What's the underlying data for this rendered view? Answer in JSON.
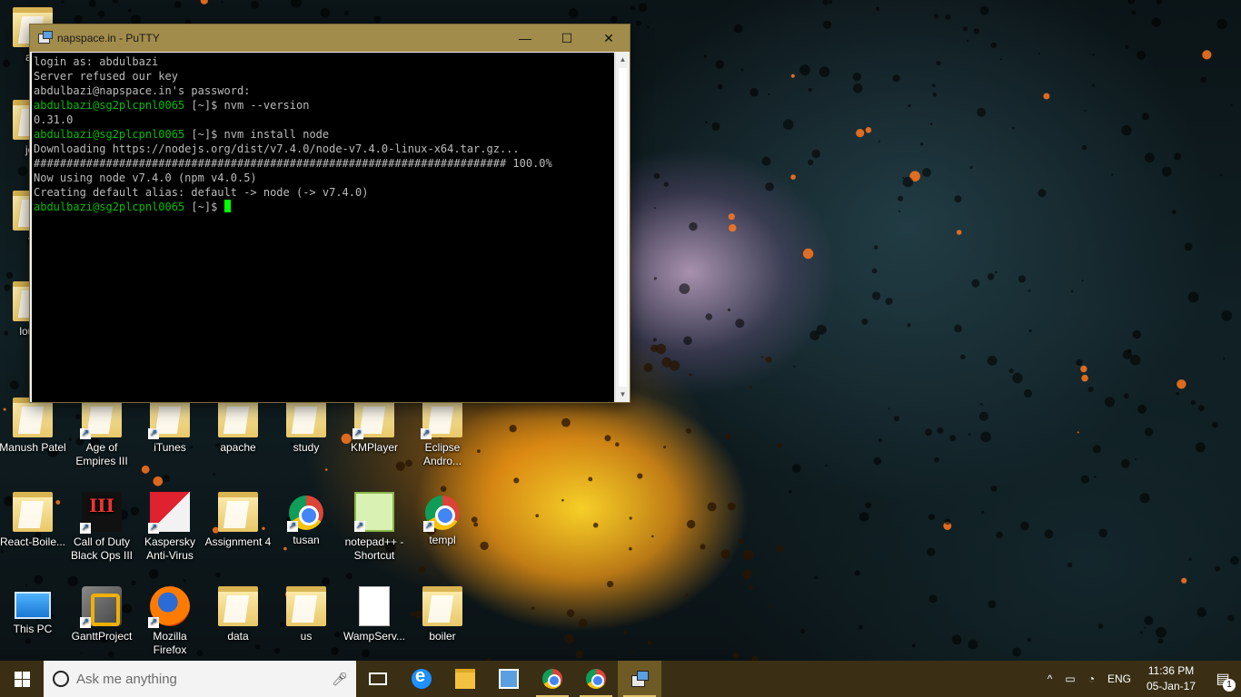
{
  "colors": {
    "titlebar": "#a28c4b",
    "taskbar": "#3a2f14",
    "terminal_bg": "#000000",
    "terminal_fg": "#bbbbbb",
    "prompt_green": "#00c000"
  },
  "putty": {
    "title": "napspace.in - PuTTY",
    "minimize_glyph": "—",
    "maximize_glyph": "☐",
    "close_glyph": "✕",
    "terminal": {
      "lines": [
        {
          "text": "login as: abdulbazi"
        },
        {
          "text": "Server refused our key"
        },
        {
          "text": "abdulbazi@napspace.in's password:"
        },
        {
          "prompt": "abdulbazi@sg2plcpnl0065",
          "text": " [~]$ nvm --version"
        },
        {
          "text": "0.31.0"
        },
        {
          "prompt": "abdulbazi@sg2plcpnl0065",
          "text": " [~]$ nvm install node"
        },
        {
          "text": "Downloading https://nodejs.org/dist/v7.4.0/node-v7.4.0-linux-x64.tar.gz..."
        },
        {
          "text": "######################################################################## 100.0%"
        },
        {
          "text": "Now using node v7.4.0 (npm v4.0.5)"
        },
        {
          "text": "Creating default alias: default -> node (-> v7.4.0)"
        },
        {
          "prompt": "abdulbazi@sg2plcpnl0065",
          "text": " [~]$ ",
          "cursor": true
        }
      ]
    }
  },
  "desktop": {
    "icons": [
      {
        "label": "api",
        "kind": "folder"
      },
      {
        "label": "jou",
        "kind": "folder"
      },
      {
        "label": "fo",
        "kind": "folder"
      },
      {
        "label": "loung",
        "kind": "folder"
      },
      {
        "label": "Manush Patel",
        "kind": "folder"
      },
      {
        "label": "Age of Empires III",
        "kind": "shortcut"
      },
      {
        "label": "iTunes",
        "kind": "shortcut"
      },
      {
        "label": "apache",
        "kind": "folder"
      },
      {
        "label": "study",
        "kind": "folder"
      },
      {
        "label": "KMPlayer",
        "kind": "shortcut"
      },
      {
        "label": "Eclipse Andro...",
        "kind": "shortcut"
      },
      {
        "label": "React-Boile...",
        "kind": "folder"
      },
      {
        "label": "Call of Duty Black Ops III",
        "kind": "game"
      },
      {
        "label": "Kaspersky Anti-Virus",
        "kind": "kaspersky"
      },
      {
        "label": "Assignment 4",
        "kind": "folder"
      },
      {
        "label": "tusan",
        "kind": "chrome"
      },
      {
        "label": "notepad++ - Shortcut",
        "kind": "notepad"
      },
      {
        "label": "templ",
        "kind": "chrome"
      },
      {
        "label": "This PC",
        "kind": "pc"
      },
      {
        "label": "GanttProject",
        "kind": "gantt"
      },
      {
        "label": "Mozilla Firefox",
        "kind": "firefox"
      },
      {
        "label": "data",
        "kind": "folder"
      },
      {
        "label": "us",
        "kind": "folder"
      },
      {
        "label": "WampServ...",
        "kind": "doc"
      },
      {
        "label": "boiler",
        "kind": "folder"
      }
    ]
  },
  "taskbar": {
    "search_placeholder": "Ask me anything",
    "apps": [
      {
        "name": "task-view",
        "icon": "taskview-icon"
      },
      {
        "name": "edge",
        "icon": "edge-icon"
      },
      {
        "name": "file-explorer",
        "icon": "folder-icon"
      },
      {
        "name": "store",
        "icon": "store-icon"
      },
      {
        "name": "chrome-1",
        "icon": "chrome-icon"
      },
      {
        "name": "chrome-2",
        "icon": "chrome-icon"
      },
      {
        "name": "putty",
        "icon": "putty-icon"
      }
    ],
    "tray": {
      "chevron": "^",
      "language": "ENG",
      "time": "11:36 PM",
      "date": "05-Jan-17",
      "notification_count": "1"
    }
  }
}
